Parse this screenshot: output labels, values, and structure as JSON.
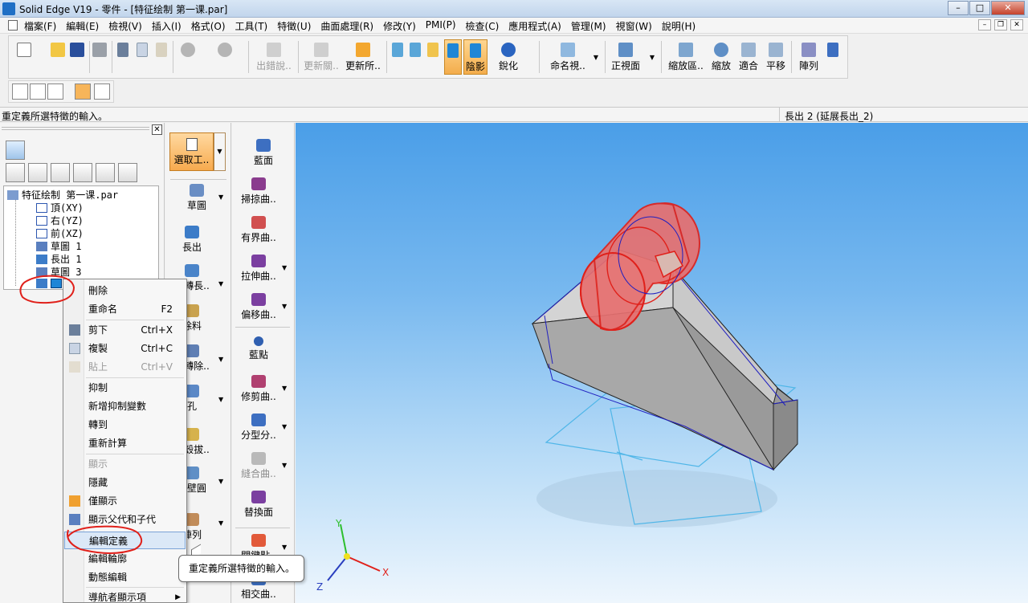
{
  "window": {
    "title": "Solid Edge V19 - 零件 - [特征绘制 第一课.par]"
  },
  "menubar": [
    "檔案(F)",
    "編輯(E)",
    "檢視(V)",
    "插入(I)",
    "格式(O)",
    "工具(T)",
    "特徵(U)",
    "曲面處理(R)",
    "修改(Y)",
    "PMI(P)",
    "檢查(C)",
    "應用程式(A)",
    "管理(M)",
    "視窗(W)",
    "說明(H)"
  ],
  "toolbar": {
    "show_errors": "出錯說..",
    "update_related": "更新關..",
    "update_all": "更新所..",
    "shaded": "陰影",
    "sharpen": "銳化",
    "named_view": "命名視..",
    "front_view": "正視面",
    "zoom_area": "縮放區..",
    "zoom": "縮放",
    "fit": "適合",
    "pan": "平移",
    "array": "陣列"
  },
  "prompt": {
    "left": "重定義所選特徵的輸入。",
    "right": "長出 2 (延展長出_2)"
  },
  "tree": {
    "root": "特征绘制 第一课.par",
    "items": [
      "頂(XY)",
      "右(YZ)",
      "前(XZ)",
      "草圖 1",
      "長出 1",
      "草圖 3"
    ]
  },
  "commands_left": [
    "選取工..",
    "草圖",
    "長出",
    "旋轉長..",
    "除料",
    "旋轉除..",
    "孔",
    "薄殼拔..",
    "薄壁圓",
    "陣列"
  ],
  "commands_right": [
    "藍面",
    "掃掠曲..",
    "有界曲..",
    "拉伸曲..",
    "偏移曲..",
    "藍點",
    "修剪曲..",
    "分型分..",
    "縫合曲..",
    "替換面",
    "關鍵點..",
    "相交曲.."
  ],
  "context_menu": {
    "items": [
      {
        "label": "刪除",
        "shortcut": ""
      },
      {
        "label": "重命名",
        "shortcut": "F2"
      },
      {
        "label": "剪下",
        "shortcut": "Ctrl+X"
      },
      {
        "label": "複製",
        "shortcut": "Ctrl+C"
      },
      {
        "label": "貼上",
        "shortcut": "Ctrl+V"
      },
      {
        "label": "抑制",
        "shortcut": ""
      },
      {
        "label": "新增抑制變數",
        "shortcut": ""
      },
      {
        "label": "轉到",
        "shortcut": ""
      },
      {
        "label": "重新計算",
        "shortcut": ""
      },
      {
        "label": "顯示",
        "shortcut": ""
      },
      {
        "label": "隱藏",
        "shortcut": ""
      },
      {
        "label": "僅顯示",
        "shortcut": ""
      },
      {
        "label": "顯示父代和子代",
        "shortcut": ""
      },
      {
        "label": "編輯定義",
        "shortcut": ""
      },
      {
        "label": "編輯輪廓",
        "shortcut": ""
      },
      {
        "label": "動態編輯",
        "shortcut": ""
      },
      {
        "label": "導航者顯示項",
        "shortcut": ""
      }
    ]
  },
  "tooltip": "重定義所選特徵的輸入。",
  "triad": {
    "x": "X",
    "y": "Y",
    "z": "Z"
  },
  "colors": {
    "highlight": "#f7aa4e",
    "selection_red": "#e0201a",
    "viewport_top": "#4a9ee8"
  }
}
